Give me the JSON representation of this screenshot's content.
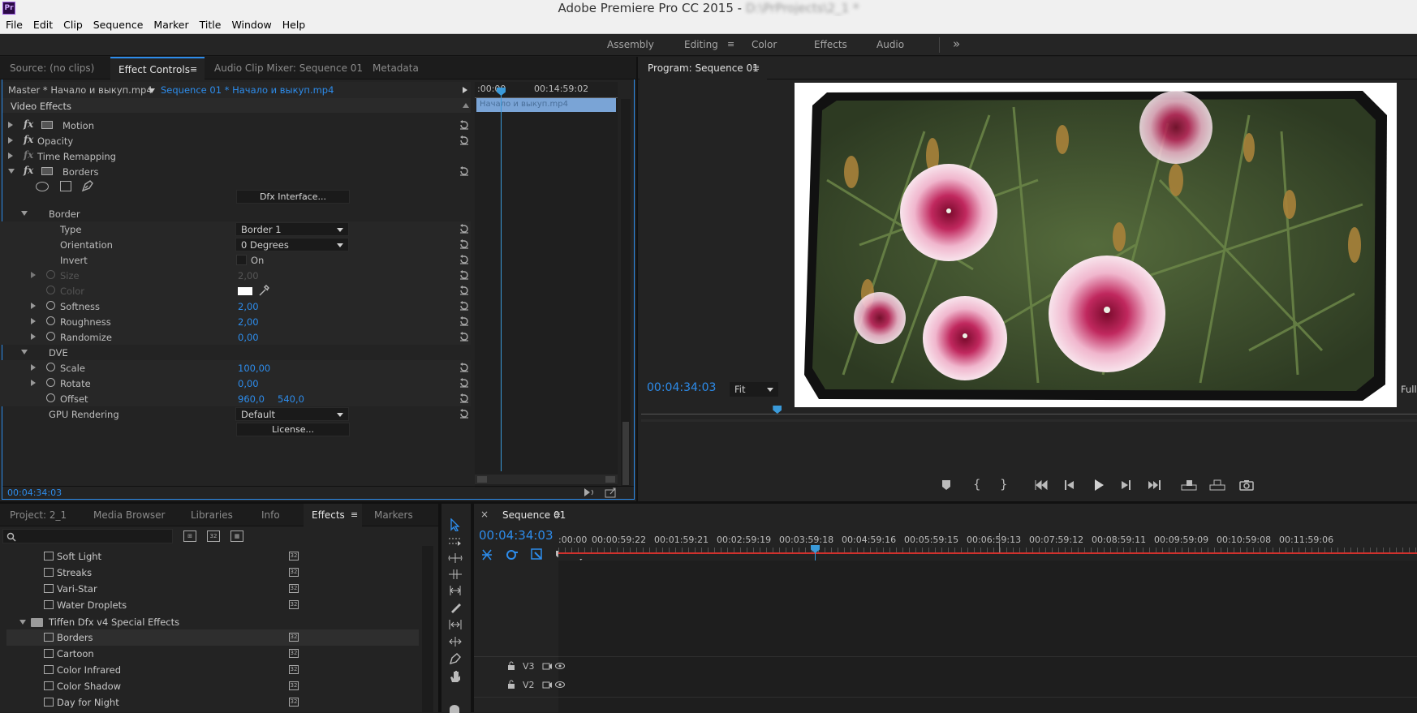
{
  "app": {
    "title": "Adobe Premiere Pro CC 2015 - ",
    "title_blurred_path": "D:\\PrProjects\\2_1 *",
    "logo": "Pr"
  },
  "menu": [
    "File",
    "Edit",
    "Clip",
    "Sequence",
    "Marker",
    "Title",
    "Window",
    "Help"
  ],
  "workspaces": {
    "items": [
      "Assembly",
      "Editing",
      "Color",
      "Effects",
      "Audio"
    ],
    "active": "Editing",
    "overflow": "»"
  },
  "effect_controls": {
    "tabs": [
      "Source: (no clips)",
      "Effect Controls",
      "Audio Clip Mixer: Sequence 01",
      "Metadata"
    ],
    "menu_icon": "≡",
    "master_clip": "Master * Начало и выкуп.mp4",
    "sequence_clip": "Sequence 01 * Начало и выкуп.mp4",
    "mini_ruler": [
      ":00:00",
      "00:14:59:02"
    ],
    "clip_bar_label": "Начало и выкуп.mp4",
    "section": "Video Effects",
    "effects": [
      "Motion",
      "Opacity",
      "Time Remapping",
      "Borders"
    ],
    "dfx_button": "Dfx Interface...",
    "border_group": "Border",
    "type_label": "Type",
    "type_value": "Border 1",
    "orientation_label": "Orientation",
    "orientation_value": "0 Degrees",
    "invert_label": "Invert",
    "invert_value": "On",
    "size_label": "Size",
    "size_value": "2,00",
    "color_label": "Color",
    "softness_label": "Softness",
    "softness_value": "2,00",
    "roughness_label": "Roughness",
    "roughness_value": "2,00",
    "randomize_label": "Randomize",
    "randomize_value": "0,00",
    "dve_group": "DVE",
    "scale_label": "Scale",
    "scale_value": "100,00",
    "rotate_label": "Rotate",
    "rotate_value": "0,00",
    "offset_label": "Offset",
    "offset_x": "960,0",
    "offset_y": "540,0",
    "gpu_label": "GPU Rendering",
    "gpu_value": "Default",
    "license_button": "License...",
    "timecode": "00:04:34:03"
  },
  "program": {
    "title": "Program: Sequence 01",
    "menu_icon": "≡",
    "timecode": "00:04:34:03",
    "fit": "Fit",
    "full": "Full",
    "playhead_fraction": 0.25
  },
  "project": {
    "tabs": [
      "Project: 2_1",
      "Media Browser",
      "Libraries",
      "Info",
      "Effects",
      "Markers"
    ],
    "active_tab": "Effects",
    "menu_icon": "≡",
    "effects_list": [
      {
        "name": "Soft Light",
        "type": "effect"
      },
      {
        "name": "Streaks",
        "type": "effect"
      },
      {
        "name": "Vari-Star",
        "type": "effect"
      },
      {
        "name": "Water Droplets",
        "type": "effect"
      },
      {
        "name": "Tiffen Dfx v4 Special Effects",
        "type": "folder"
      },
      {
        "name": "Borders",
        "type": "effect"
      },
      {
        "name": "Cartoon",
        "type": "effect"
      },
      {
        "name": "Color Infrared",
        "type": "effect"
      },
      {
        "name": "Color Shadow",
        "type": "effect"
      },
      {
        "name": "Day for Night",
        "type": "effect"
      }
    ]
  },
  "timeline": {
    "tab": "Sequence 01",
    "menu_icon": "≡",
    "close_icon": "×",
    "timecode": "00:04:34:03",
    "ruler": [
      ":00:00",
      "00:00:59:22",
      "00:01:59:21",
      "00:02:59:19",
      "00:03:59:18",
      "00:04:59:16",
      "00:05:59:15",
      "00:06:59:13",
      "00:07:59:12",
      "00:08:59:11",
      "00:09:59:09",
      "00:10:59:08",
      "00:11:59:06"
    ],
    "tracks": [
      "V3",
      "V2"
    ]
  },
  "colors": {
    "accent": "#2d8ceb",
    "panel": "#232323",
    "bg": "#1e1e1e",
    "playhead": "#3a9ad9",
    "workarea": "#d0312d"
  }
}
